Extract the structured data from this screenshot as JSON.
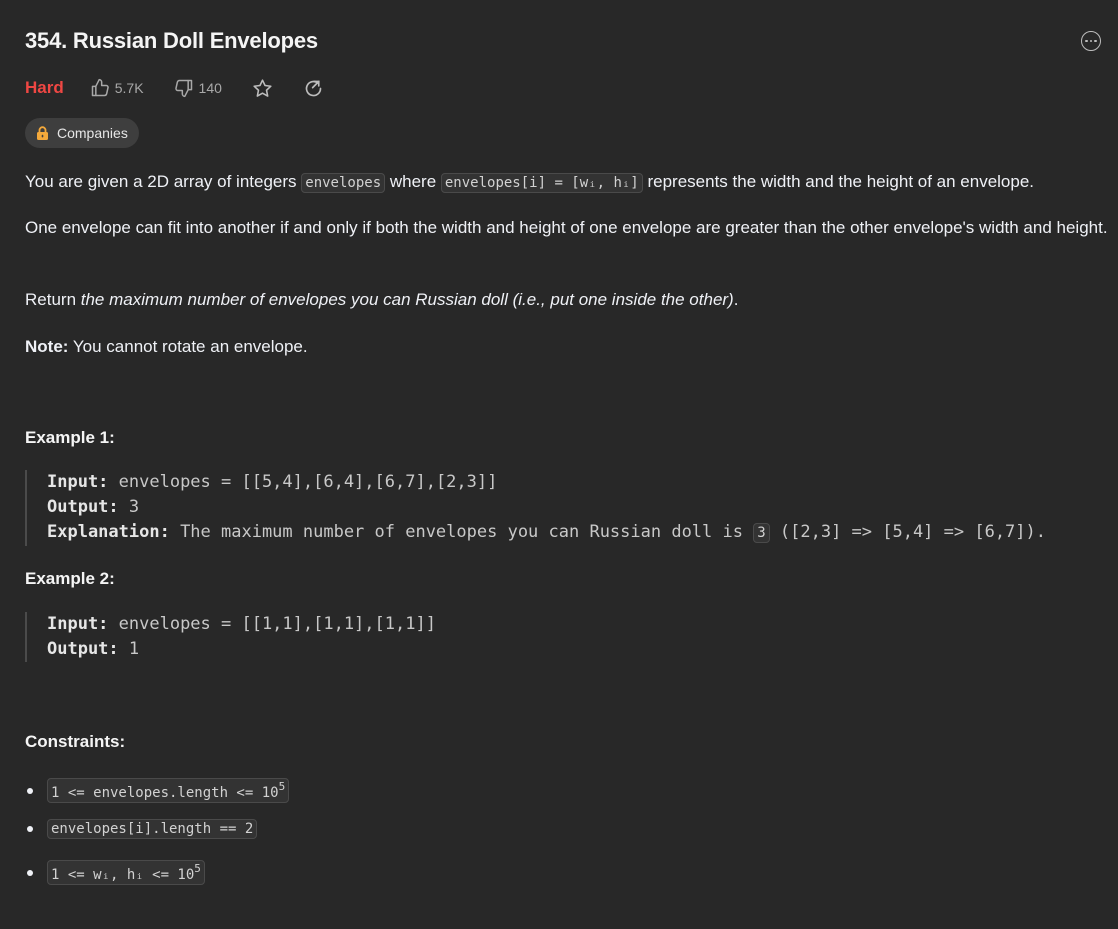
{
  "problem": {
    "title": "354. Russian Doll Envelopes",
    "difficulty": "Hard",
    "likes": "5.7K",
    "dislikes": "140",
    "companies_label": "Companies"
  },
  "description": {
    "p1_a": "You are given a 2D array of integers ",
    "p1_code1": "envelopes",
    "p1_b": " where ",
    "p1_code2": "envelopes[i] = [wᵢ, hᵢ]",
    "p1_c": " represents the width and the height of an envelope.",
    "p2": "One envelope can fit into another if and only if both the width and height of one envelope are greater than the other envelope's width and height.",
    "p3_a": "Return ",
    "p3_em": "the maximum number of envelopes you can Russian doll (i.e., put one inside the other)",
    "p3_b": ".",
    "p4_bold": "Note:",
    "p4_text": " You cannot rotate an envelope."
  },
  "example1": {
    "title": "Example 1:",
    "input_label": "Input:",
    "input_value": " envelopes = [[5,4],[6,4],[6,7],[2,3]]",
    "output_label": "Output:",
    "output_value": " 3",
    "explanation_label": "Explanation:",
    "explanation_text": " The maximum number of envelopes you can Russian doll is ",
    "explanation_code": "3",
    "explanation_tail": " ([2,3] => [5,4] => [6,7])."
  },
  "example2": {
    "title": "Example 2:",
    "input_label": "Input:",
    "input_value": " envelopes = [[1,1],[1,1],[1,1]]",
    "output_label": "Output:",
    "output_value": " 1"
  },
  "constraints": {
    "title": "Constraints:",
    "c1": "1 <= envelopes.length <= 10",
    "c1_sup": "5",
    "c2": "envelopes[i].length == 2",
    "c3": "1 <= wᵢ, hᵢ <= 10",
    "c3_sup": "5"
  }
}
